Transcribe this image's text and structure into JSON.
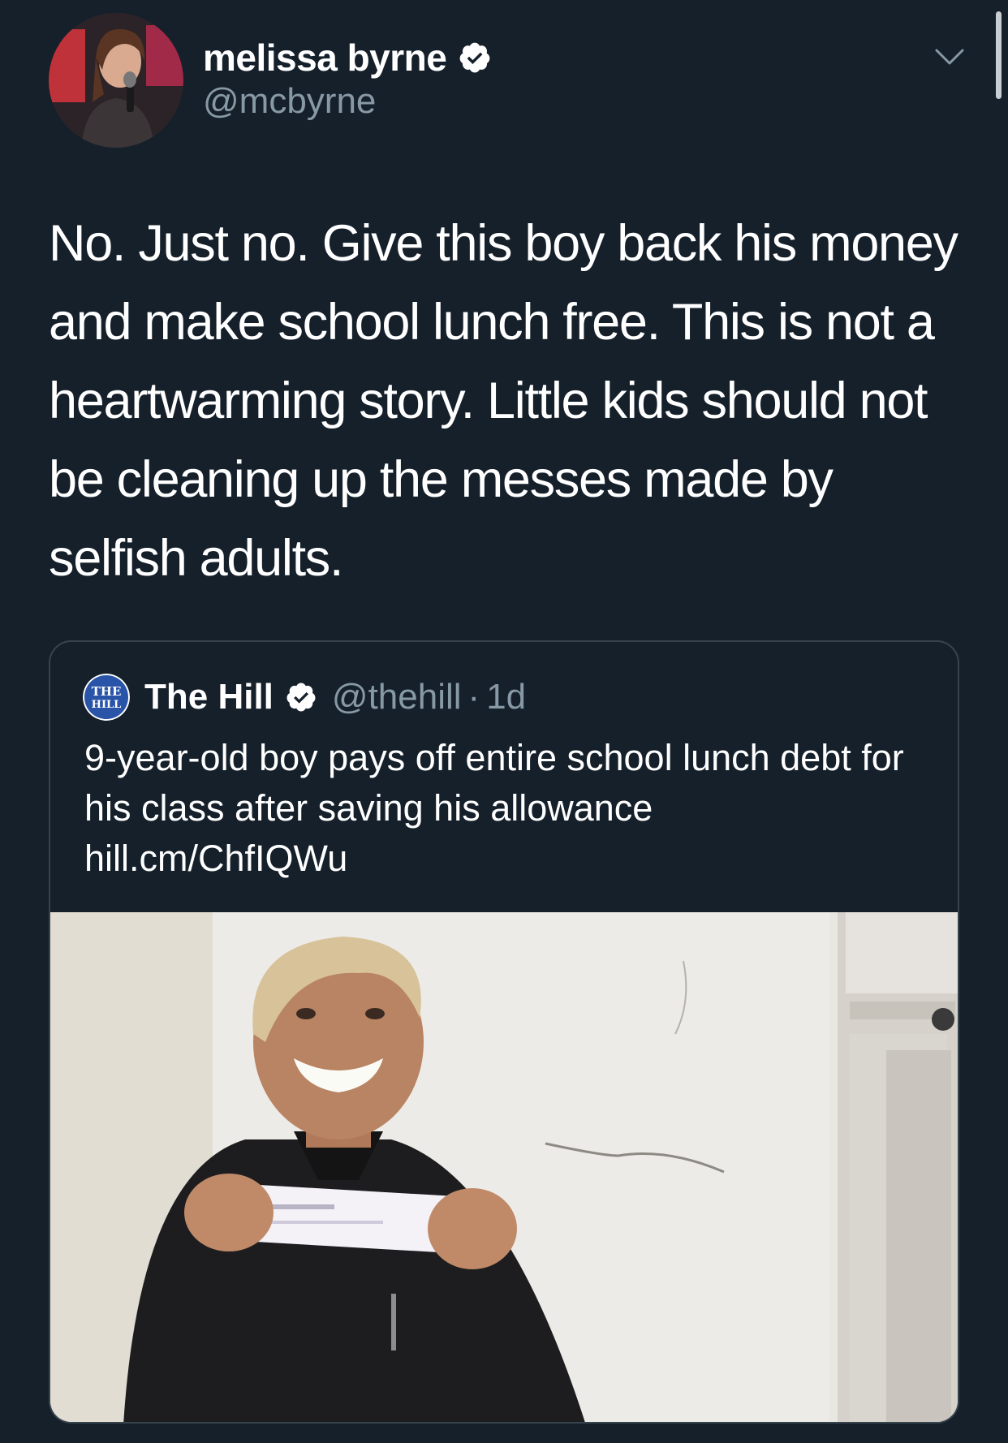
{
  "author": {
    "display_name": "melissa byrne",
    "handle": "@mcbyrne",
    "avatar_icon": "profile-photo",
    "verified_icon": "verified-badge-icon"
  },
  "tweet": {
    "text": "No. Just no. Give this boy back his money and make school lunch free. This is not a heartwarming story. Little kids should not be cleaning up the messes made by selfish adults."
  },
  "quoted_tweet": {
    "display_name": "The Hill",
    "handle": "@thehill",
    "separator": "·",
    "time": "1d",
    "text": "9-year-old boy pays off entire school lunch debt for his class after saving his allowance",
    "link": "hill.cm/ChfIQWu",
    "logo_text_top": "THE",
    "logo_text_bottom": "HILL"
  },
  "colors": {
    "background": "#15202b",
    "secondary_text": "#8899a6",
    "border": "#38444d",
    "verified_badge": "#ffffff"
  }
}
